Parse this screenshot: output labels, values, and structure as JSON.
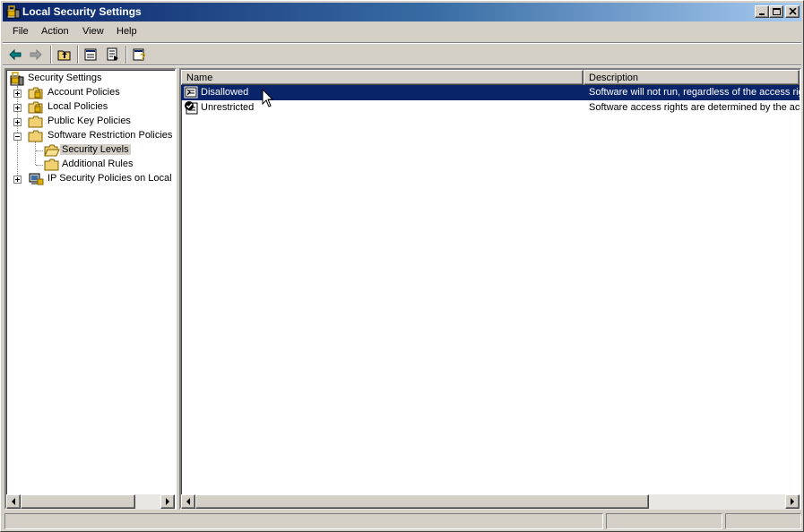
{
  "window": {
    "title": "Local Security Settings"
  },
  "menu": [
    {
      "label": "File"
    },
    {
      "label": "Action"
    },
    {
      "label": "View"
    },
    {
      "label": "Help"
    }
  ],
  "tree": {
    "root": "Security Settings",
    "items": [
      {
        "label": "Account Policies"
      },
      {
        "label": "Local Policies"
      },
      {
        "label": "Public Key Policies"
      },
      {
        "label": "Software Restriction Policies"
      },
      {
        "label": "Security Levels"
      },
      {
        "label": "Additional Rules"
      },
      {
        "label": "IP Security Policies on Local Computer"
      }
    ]
  },
  "list": {
    "columns": {
      "name": "Name",
      "description": "Description"
    },
    "rows": [
      {
        "name": "Disallowed",
        "description": "Software will not run, regardless of the access rights of the user."
      },
      {
        "name": "Unrestricted",
        "description": "Software access rights are determined by the access rights of the user."
      }
    ]
  },
  "colors": {
    "titlebar": "#0a246a",
    "selection": "#0a246a",
    "face": "#d4d0c8"
  }
}
